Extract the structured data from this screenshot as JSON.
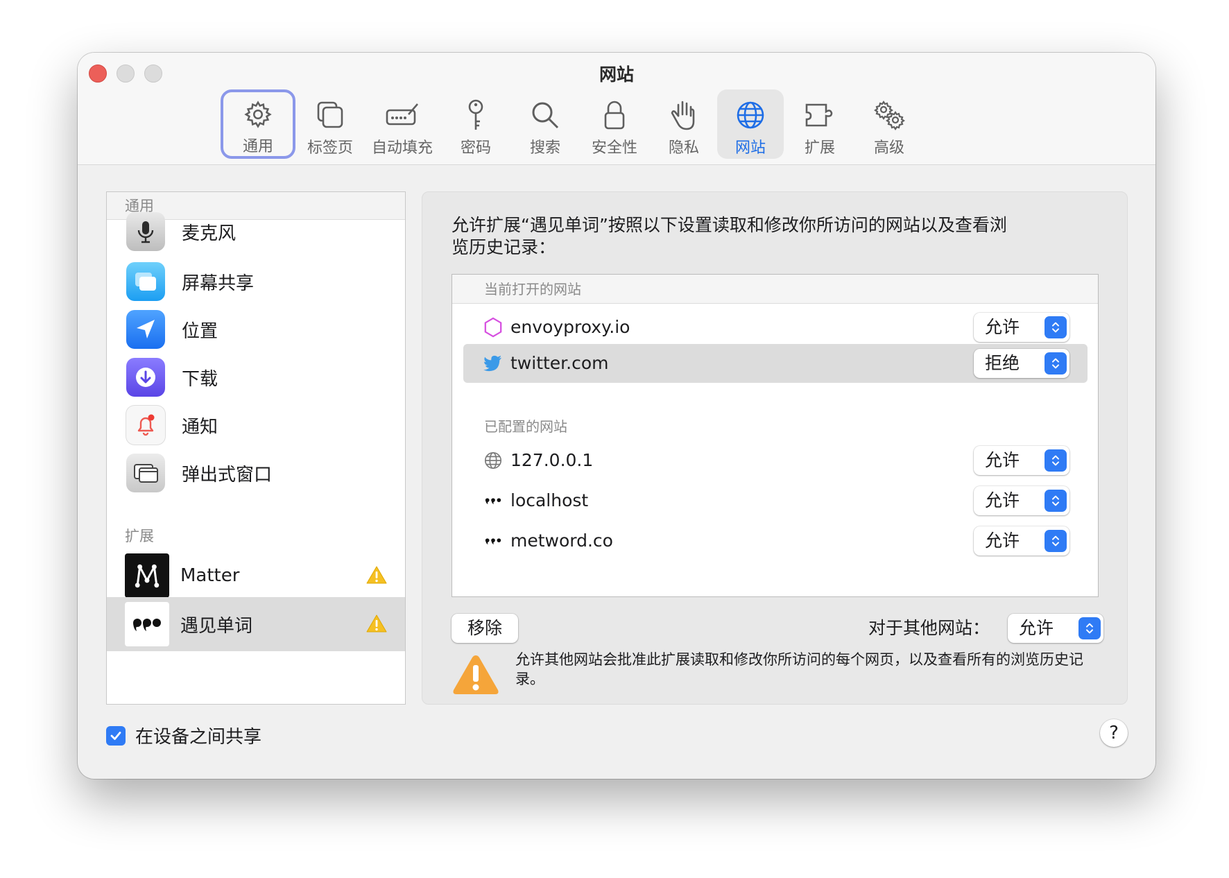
{
  "window": {
    "title": "网站"
  },
  "toolbar": {
    "items": [
      {
        "label": "通用",
        "icon": "gear-icon"
      },
      {
        "label": "标签页",
        "icon": "tabs-icon"
      },
      {
        "label": "自动填充",
        "icon": "autofill-icon"
      },
      {
        "label": "密码",
        "icon": "key-icon"
      },
      {
        "label": "搜索",
        "icon": "search-icon"
      },
      {
        "label": "安全性",
        "icon": "lock-icon"
      },
      {
        "label": "隐私",
        "icon": "hand-icon"
      },
      {
        "label": "网站",
        "icon": "globe-icon"
      },
      {
        "label": "扩展",
        "icon": "puzzle-icon"
      },
      {
        "label": "高级",
        "icon": "gears-icon"
      }
    ],
    "selected": "网站",
    "focused": "通用"
  },
  "sidebar": {
    "general_header": "通用",
    "items": [
      {
        "label": "麦克风",
        "icon": "microphone-icon"
      },
      {
        "label": "屏幕共享",
        "icon": "screen-share-icon"
      },
      {
        "label": "位置",
        "icon": "location-icon"
      },
      {
        "label": "下载",
        "icon": "download-icon"
      },
      {
        "label": "通知",
        "icon": "bell-icon"
      },
      {
        "label": "弹出式窗口",
        "icon": "popup-window-icon"
      }
    ],
    "extensions_header": "扩展",
    "extensions": [
      {
        "label": "Matter",
        "icon": "matter-logo-icon",
        "warning": true
      },
      {
        "label": "遇见单词",
        "icon": "metword-logo-icon",
        "warning": true,
        "selected": true
      }
    ]
  },
  "panel": {
    "description": "允许扩展“遇见单词”按照以下设置读取和修改你所访问的网站以及查看浏览历史记录：",
    "open_header": "当前打开的网站",
    "open_sites": [
      {
        "name": "envoyproxy.io",
        "setting": "允许",
        "icon": "hexagon-icon"
      },
      {
        "name": "twitter.com",
        "setting": "拒绝",
        "icon": "twitter-bird-icon",
        "selected": true
      }
    ],
    "configured_header": "已配置的网站",
    "configured_sites": [
      {
        "name": "127.0.0.1",
        "setting": "允许",
        "icon": "globe-icon"
      },
      {
        "name": "localhost",
        "setting": "允许",
        "icon": "metword-dots-icon"
      },
      {
        "name": "metword.co",
        "setting": "允许",
        "icon": "metword-dots-icon"
      }
    ],
    "remove_label": "移除",
    "other_label": "对于其他网站：",
    "other_setting": "允许",
    "warning_text": "允许其他网站会批准此扩展读取和修改你所访问的每个网页，以及查看所有的浏览历史记录。"
  },
  "footer": {
    "share_label": "在设备之间共享",
    "share_checked": true,
    "help_label": "?"
  },
  "colors": {
    "accent": "#2f7bf5",
    "focus_ring": "#8b98ea",
    "warning": "#f5a623",
    "close": "#ec5f59"
  }
}
